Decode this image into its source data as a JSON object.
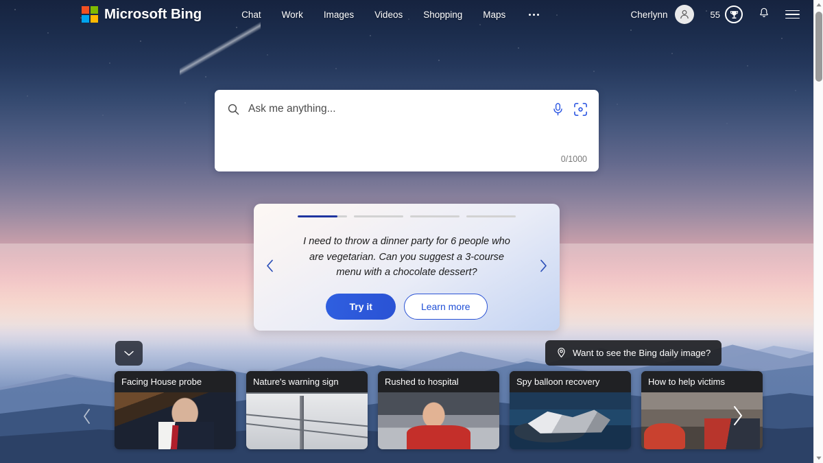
{
  "header": {
    "brand": "Microsoft Bing",
    "logo_colors": [
      "#f25022",
      "#7fba00",
      "#00a4ef",
      "#ffb900"
    ],
    "nav": [
      {
        "label": "Chat"
      },
      {
        "label": "Work"
      },
      {
        "label": "Images"
      },
      {
        "label": "Videos"
      },
      {
        "label": "Shopping"
      },
      {
        "label": "Maps"
      }
    ],
    "more_label": "More",
    "user_name": "Cherlynn",
    "rewards_count": "55",
    "avatar_icon": "person-icon",
    "rewards_icon": "trophy-icon",
    "notifications_icon": "bell-icon",
    "menu_icon": "hamburger-icon"
  },
  "search": {
    "value": "",
    "placeholder": "Ask me anything...",
    "counter": "0/1000",
    "search_icon": "search-icon",
    "mic_icon": "microphone-icon",
    "visual_icon": "visual-search-icon",
    "accent": "#174ae4"
  },
  "suggestion_card": {
    "progress": [
      {
        "fill": 80
      },
      {
        "fill": 0
      },
      {
        "fill": 0
      },
      {
        "fill": 0
      }
    ],
    "prompt": "I need to throw a dinner party for 6 people who are vegetarian. Can you suggest a 3-course menu with a chocolate dessert?",
    "primary_button": "Try it",
    "secondary_button": "Learn more",
    "prev_icon": "chevron-left-icon",
    "next_icon": "chevron-right-icon",
    "accent": "#1f35a0"
  },
  "daily_image_pill": {
    "label": "Want to see the Bing daily image?",
    "icon": "location-pin-icon"
  },
  "collapse_button": {
    "icon": "chevron-down-icon"
  },
  "news": {
    "prev_icon": "chevron-left-icon",
    "next_icon": "chevron-right-icon",
    "cards": [
      {
        "title": "Facing House probe",
        "thumb": "th-congress"
      },
      {
        "title": "Nature's warning sign",
        "thumb": "th-wires"
      },
      {
        "title": "Rushed to hospital",
        "thumb": "th-crowd"
      },
      {
        "title": "Spy balloon recovery",
        "thumb": "th-balloon"
      },
      {
        "title": "How to help victims",
        "thumb": "th-rescue"
      }
    ]
  },
  "scrollbar": {
    "up_icon": "triangle-up-icon",
    "down_icon": "triangle-down-icon"
  }
}
